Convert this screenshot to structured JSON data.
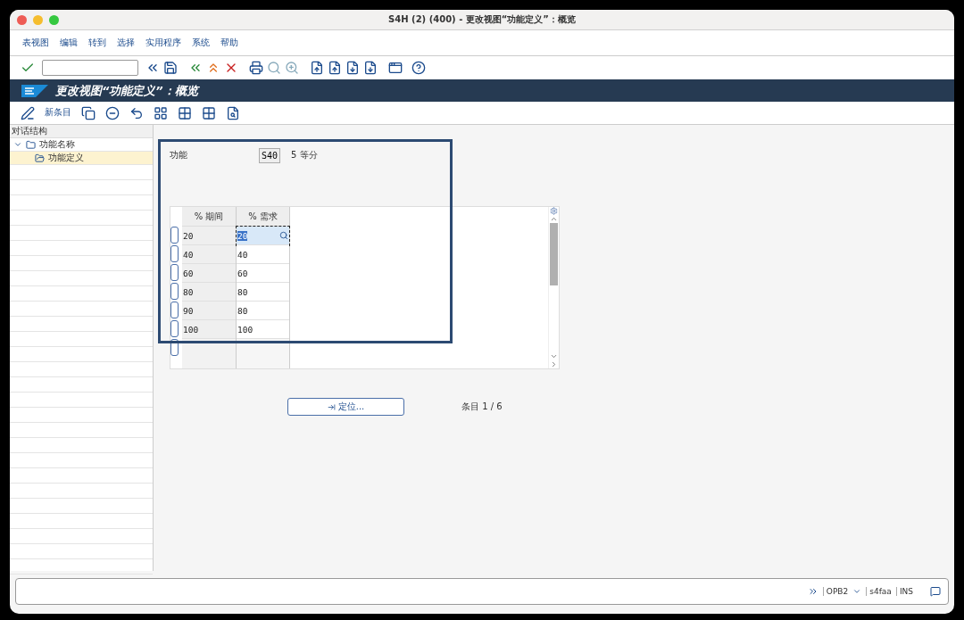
{
  "window": {
    "title": "S4H (2) (400) - 更改视图“功能定义”：概览"
  },
  "menu": [
    "表视图",
    "编辑",
    "转到",
    "选择",
    "实用程序",
    "系统",
    "帮助"
  ],
  "screen_title": "更改视图“功能定义”：概览",
  "app_toolbar": {
    "new_entries": "新条目"
  },
  "dialog_structure": {
    "title": "对话结构",
    "items": [
      {
        "label": "功能名称",
        "expanded": true,
        "selected": false,
        "children": [
          {
            "label": "功能定义",
            "selected": true
          }
        ]
      }
    ]
  },
  "function": {
    "label": "功能",
    "code": "S40",
    "description": "5 等分"
  },
  "table": {
    "columns": [
      "% 期间",
      "% 需求"
    ],
    "rows": [
      {
        "cells": [
          "20",
          "20"
        ],
        "focused": true
      },
      {
        "cells": [
          "40",
          "40"
        ],
        "focused": false
      },
      {
        "cells": [
          "60",
          "60"
        ],
        "focused": false
      },
      {
        "cells": [
          "80",
          "80"
        ],
        "focused": false
      },
      {
        "cells": [
          "90",
          "80"
        ],
        "focused": false
      },
      {
        "cells": [
          "100",
          "100"
        ],
        "focused": false
      }
    ]
  },
  "position_button": "定位...",
  "entry_count": "条目 1 / 6",
  "status_bar": {
    "transaction": "OPB2",
    "server": "s4faa",
    "mode": "INS"
  }
}
